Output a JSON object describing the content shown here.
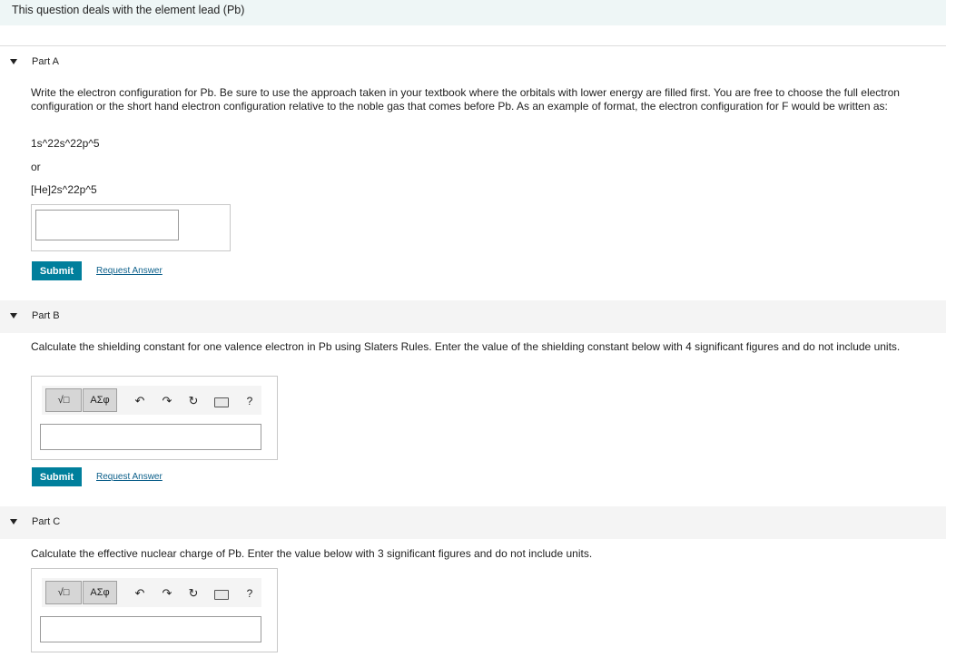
{
  "banner": {
    "text": "This question deals with the element lead (Pb)"
  },
  "partA": {
    "label": "Part A",
    "prompt": "Write the electron configuration for Pb. Be sure to use the approach taken in your textbook where the orbitals with lower energy are filled first. You are free to choose the full electron configuration or the short hand electron configuration relative to the noble gas that comes before Pb. As an example of format, the electron configuration for F would be written as:",
    "example1": "1s^22s^22p^5",
    "or": "or",
    "example2": "[He]2s^22p^5",
    "input_value": "",
    "submit": "Submit",
    "request": "Request Answer"
  },
  "partB": {
    "label": "Part B",
    "prompt": "Calculate the shielding constant for one valence electron in Pb using Slaters Rules. Enter the value of the shielding constant below with 4 significant figures and do not include units.",
    "toolbar": {
      "templates": "√□",
      "greek": "ΑΣφ",
      "undo": "↶",
      "redo": "↷",
      "reset": "↻",
      "help": "?"
    },
    "input_value": "",
    "submit": "Submit",
    "request": "Request Answer"
  },
  "partC": {
    "label": "Part C",
    "prompt": "Calculate the effective nuclear charge of Pb. Enter the value below with 3 significant figures and do not include units.",
    "toolbar": {
      "templates": "√□",
      "greek": "ΑΣφ",
      "undo": "↶",
      "redo": "↷",
      "reset": "↻",
      "help": "?"
    },
    "input_value": ""
  },
  "colors": {
    "accent": "#007f9c",
    "link": "#0b5f8a",
    "banner_bg": "#eef6f6",
    "header_bg": "#f4f4f4"
  }
}
